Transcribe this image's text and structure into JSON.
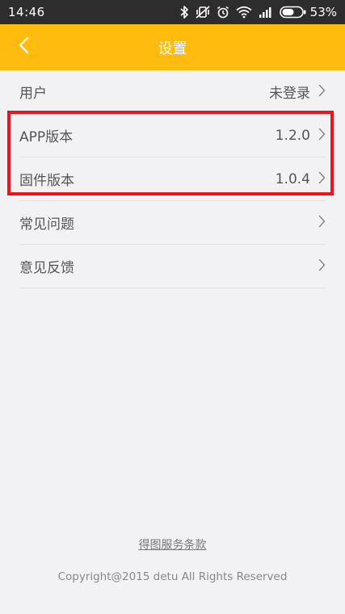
{
  "status_bar": {
    "time": "14:46",
    "battery_percent": "53%",
    "icons": [
      "bluetooth-icon",
      "vibrate-icon",
      "alarm-icon",
      "wifi-icon",
      "signal-icon",
      "battery-icon"
    ]
  },
  "nav": {
    "title": "设置",
    "back_icon": "chevron-left-icon"
  },
  "settings": {
    "user": {
      "label": "用户",
      "value": "未登录"
    },
    "app_version": {
      "label": "APP版本",
      "value": "1.2.0"
    },
    "firmware_version": {
      "label": "固件版本",
      "value": "1.0.4"
    },
    "faq": {
      "label": "常见问题",
      "value": ""
    },
    "feedback": {
      "label": "意见反馈",
      "value": ""
    }
  },
  "footer": {
    "terms_link": "得图服务条款",
    "copyright": "Copyright@2015 detu All Rights Reserved"
  },
  "colors": {
    "accent": "#ffbc0f",
    "status_bar": "#2d2d2d",
    "background": "#f2f2f4",
    "highlight": "#e8141e"
  }
}
